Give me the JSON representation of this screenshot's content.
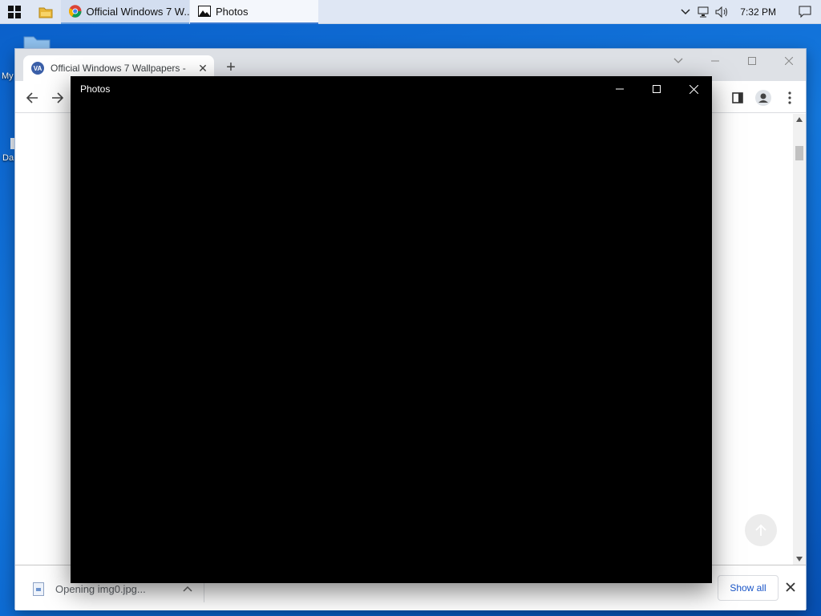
{
  "taskbar": {
    "tasks": [
      {
        "label": "Official Windows 7 W...",
        "icon": "chrome-icon"
      },
      {
        "label": "Photos",
        "icon": "photos-icon"
      }
    ],
    "clock": "7:32 PM"
  },
  "desktop": {
    "icons": [
      {
        "label": "My",
        "icon": "folder-icon"
      },
      {
        "label": "Da",
        "icon": "file-icon"
      }
    ]
  },
  "chrome": {
    "tab_title": "Official Windows 7 Wallpapers -",
    "favicon_text": "VA",
    "download": {
      "filename": "Opening img0.jpg...",
      "show_all_label": "Show all"
    }
  },
  "photos": {
    "title": "Photos"
  },
  "colors": {
    "desktop": "#1478de",
    "taskbar": "#dfe7f4",
    "photos_bg": "#000000",
    "link_blue": "#1a56c8"
  }
}
